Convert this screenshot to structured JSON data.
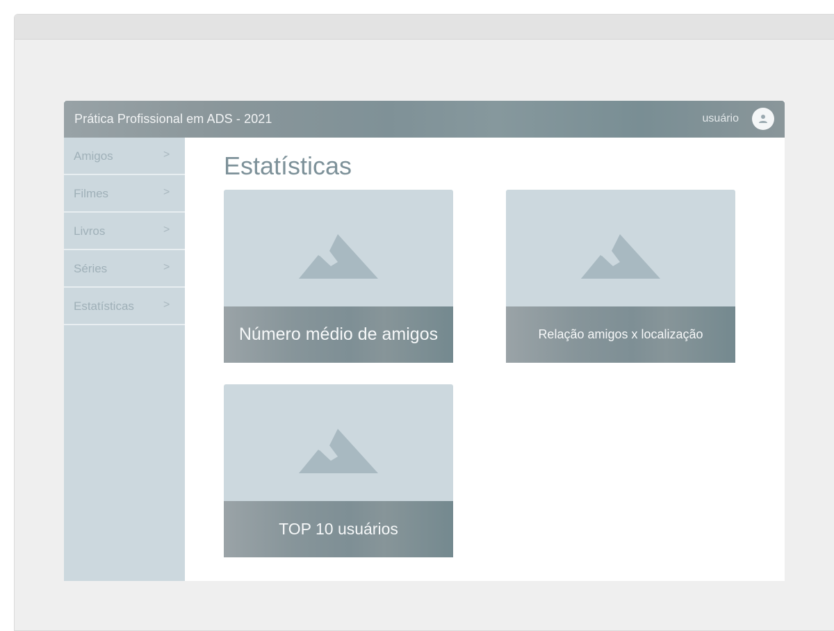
{
  "app": {
    "title": "Prática Profissional em ADS - 2021",
    "user_label": "usuário",
    "avatar_icon": "user-icon"
  },
  "sidebar": {
    "items": [
      {
        "label": "Amigos",
        "chevron": ">"
      },
      {
        "label": "Filmes",
        "chevron": ">"
      },
      {
        "label": "Livros",
        "chevron": ">"
      },
      {
        "label": "Séries",
        "chevron": ">"
      },
      {
        "label": "Estatísticas",
        "chevron": ">"
      }
    ]
  },
  "main": {
    "title": "Estatísticas",
    "cards": [
      {
        "caption": "Número médio de amigos",
        "icon": "image-placeholder-icon"
      },
      {
        "caption": "Relação amigos x localização",
        "icon": "image-placeholder-icon"
      },
      {
        "caption": "TOP 10 usuários",
        "icon": "image-placeholder-icon"
      }
    ]
  },
  "colors": {
    "header_gradient": "#86989d",
    "sidebar_bg": "#ccd8de",
    "card_bg": "#ccd8de",
    "title_text": "#7d9199"
  }
}
